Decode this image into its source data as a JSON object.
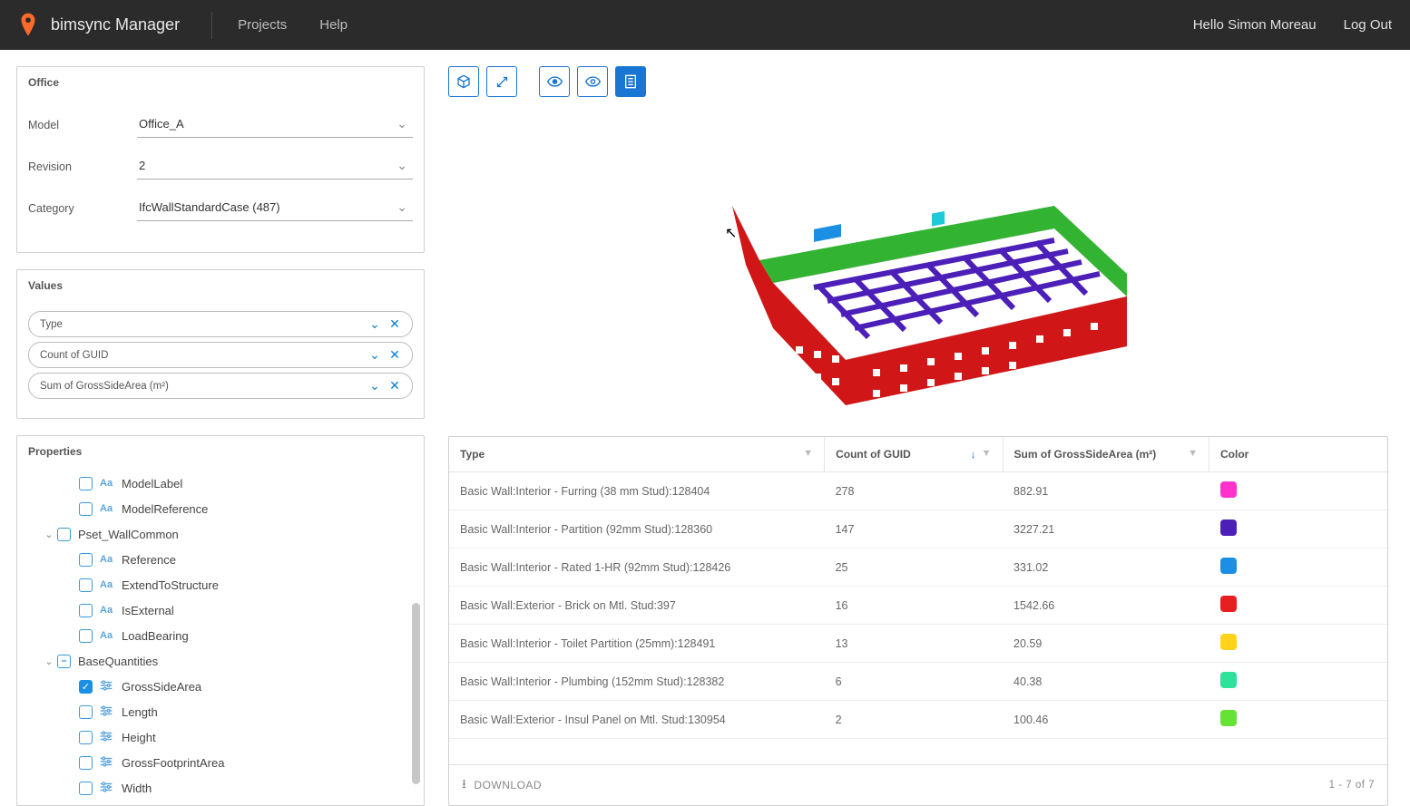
{
  "header": {
    "brand": "bimsync Manager",
    "nav": {
      "projects": "Projects",
      "help": "Help"
    },
    "greeting": "Hello Simon Moreau",
    "logout": "Log Out"
  },
  "office_panel": {
    "title": "Office",
    "model_label": "Model",
    "model_value": "Office_A",
    "revision_label": "Revision",
    "revision_value": "2",
    "category_label": "Category",
    "category_value": "IfcWallStandardCase (487)"
  },
  "values_panel": {
    "title": "Values",
    "pills": [
      {
        "label": "Type"
      },
      {
        "label": "Count of GUID"
      },
      {
        "label": "Sum of GrossSideArea (m²)"
      }
    ]
  },
  "props_panel": {
    "title": "Properties",
    "rows": [
      {
        "indent": 1,
        "check": "empty",
        "ico": "Aa",
        "label": "ModelLabel"
      },
      {
        "indent": 1,
        "check": "empty",
        "ico": "Aa",
        "label": "ModelReference"
      },
      {
        "indent": 0,
        "arrow": "v",
        "check": "empty",
        "ico": "",
        "label": "Pset_WallCommon"
      },
      {
        "indent": 1,
        "check": "empty",
        "ico": "Aa",
        "label": "Reference"
      },
      {
        "indent": 1,
        "check": "empty",
        "ico": "Aa",
        "label": "ExtendToStructure"
      },
      {
        "indent": 1,
        "check": "empty",
        "ico": "Aa",
        "label": "IsExternal"
      },
      {
        "indent": 1,
        "check": "empty",
        "ico": "Aa",
        "label": "LoadBearing"
      },
      {
        "indent": 0,
        "arrow": "v",
        "check": "mixed",
        "ico": "",
        "label": "BaseQuantities"
      },
      {
        "indent": 1,
        "check": "checked",
        "ico": "sl",
        "label": "GrossSideArea"
      },
      {
        "indent": 1,
        "check": "empty",
        "ico": "sl",
        "label": "Length"
      },
      {
        "indent": 1,
        "check": "empty",
        "ico": "sl",
        "label": "Height"
      },
      {
        "indent": 1,
        "check": "empty",
        "ico": "sl",
        "label": "GrossFootprintArea"
      },
      {
        "indent": 1,
        "check": "empty",
        "ico": "sl",
        "label": "Width"
      }
    ]
  },
  "table": {
    "headers": {
      "type": "Type",
      "count": "Count of GUID",
      "sum": "Sum of GrossSideArea (m²)",
      "color": "Color"
    },
    "rows": [
      {
        "type": "Basic Wall:Interior - Furring (38 mm Stud):128404",
        "count": "278",
        "sum": "882.91",
        "color": "#ff33cc"
      },
      {
        "type": "Basic Wall:Interior - Partition (92mm Stud):128360",
        "count": "147",
        "sum": "3227.21",
        "color": "#4b1fb8"
      },
      {
        "type": "Basic Wall:Interior - Rated 1-HR (92mm Stud):128426",
        "count": "25",
        "sum": "331.02",
        "color": "#1a8fe3"
      },
      {
        "type": "Basic Wall:Exterior - Brick on Mtl. Stud:397",
        "count": "16",
        "sum": "1542.66",
        "color": "#e62020"
      },
      {
        "type": "Basic Wall:Interior - Toilet Partition (25mm):128491",
        "count": "13",
        "sum": "20.59",
        "color": "#ffd21c"
      },
      {
        "type": "Basic Wall:Interior - Plumbing (152mm Stud):128382",
        "count": "6",
        "sum": "40.38",
        "color": "#2de29a"
      },
      {
        "type": "Basic Wall:Exterior - Insul Panel on Mtl. Stud:130954",
        "count": "2",
        "sum": "100.46",
        "color": "#65e234"
      }
    ],
    "download": "DOWNLOAD",
    "range": "1 - 7 of 7"
  }
}
